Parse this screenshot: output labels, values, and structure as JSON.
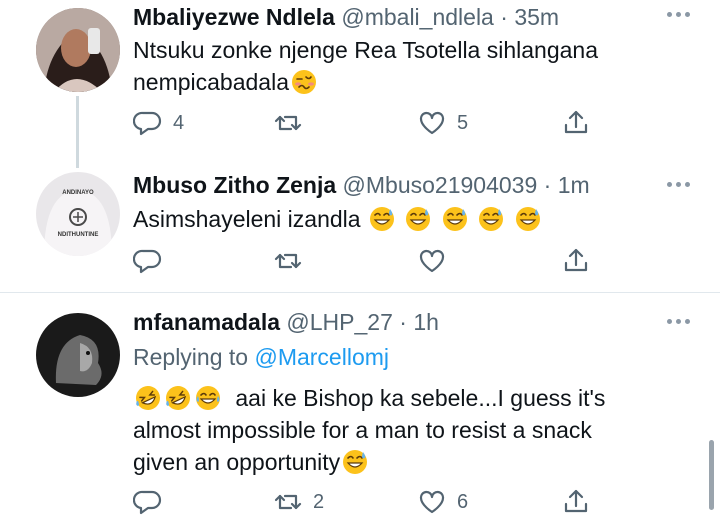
{
  "tweets": [
    {
      "name": "Mbaliyezwe Ndlela",
      "handle": "@mbali_ndlela",
      "dot": "·",
      "time": "35m",
      "line1": "Ntsuku zonke njenge Rea Tsotella sihlangana",
      "line2": "nempicabadala",
      "replies": "4",
      "retweets": "",
      "likes": "5",
      "emojis_line2": [
        "woozy-face"
      ]
    },
    {
      "name": "Mbuso Zitho Zenja",
      "handle": "@Mbuso21904039",
      "dot": "·",
      "time": "1m",
      "line1": "Asimshayeleni izandla",
      "replies": "",
      "retweets": "",
      "likes": "",
      "emojis_line1": [
        "sweat-smile",
        "sweat-smile",
        "sweat-smile",
        "sweat-smile",
        "sweat-smile"
      ],
      "avatar_text_top": "ANDINAYO",
      "avatar_text_bottom": "NDITHUNTINE"
    },
    {
      "name": "mfanamadala",
      "handle": "@LHP_27",
      "dot": "·",
      "time": "1h",
      "replying_label": "Replying to",
      "replying_handle": "@Marcellomj",
      "line1": "aai ke Bishop ka sebele...I guess it's",
      "line2": "almost impossible for a man to resist a snack",
      "line3": "given an opportunity",
      "replies": "",
      "retweets": "2",
      "likes": "6",
      "emojis_line1": [
        "rofl",
        "rofl",
        "joy"
      ],
      "emojis_line3": [
        "sweat-smile"
      ]
    }
  ],
  "colors": {
    "text": "#0f1419",
    "secondary": "#536471",
    "link": "#1d9bf0",
    "divider": "#e1e8ed"
  },
  "icons": [
    "reply-icon",
    "retweet-icon",
    "like-icon",
    "share-icon",
    "more-icon"
  ]
}
